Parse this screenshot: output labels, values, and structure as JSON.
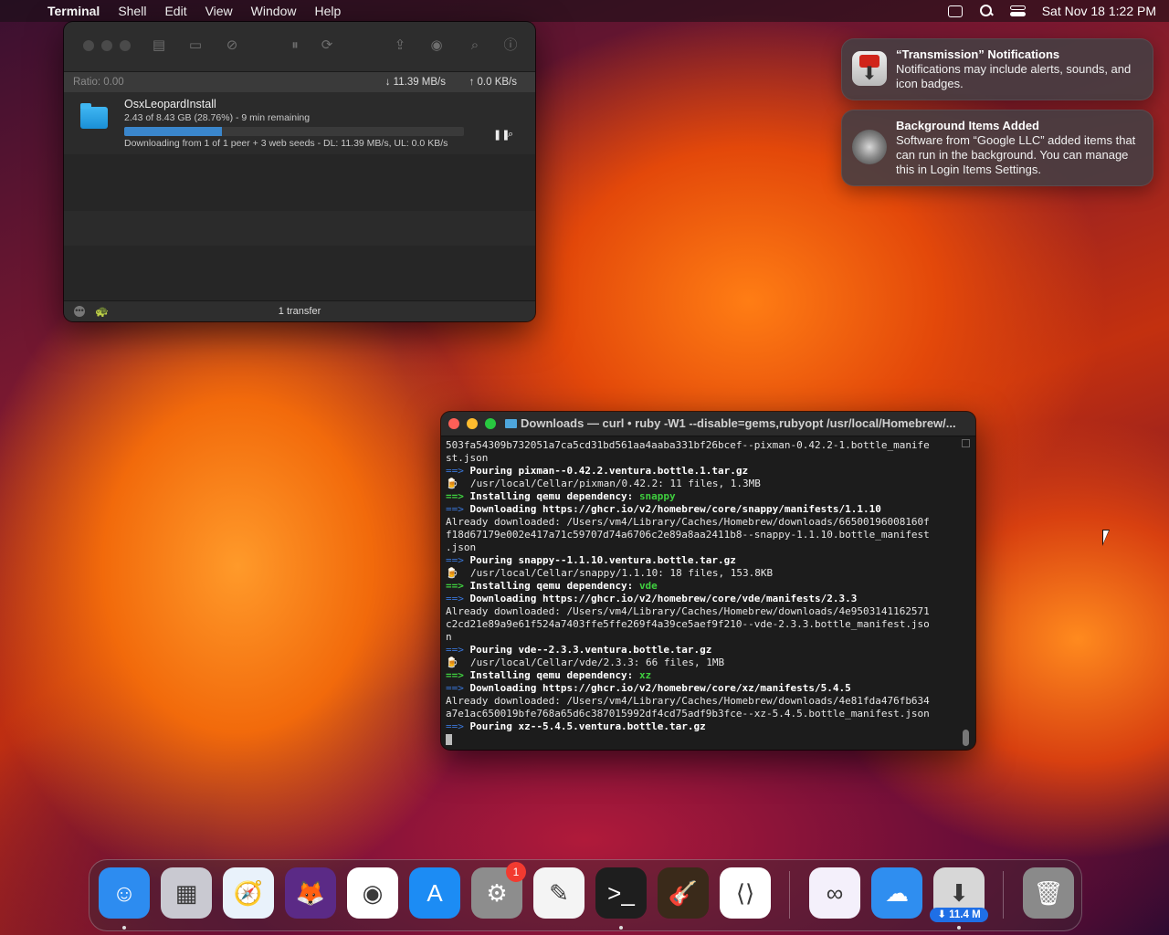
{
  "menubar": {
    "app_name": "Terminal",
    "menus": [
      "Shell",
      "Edit",
      "View",
      "Window",
      "Help"
    ],
    "clock": "Sat Nov 18  1:22 PM"
  },
  "transmission": {
    "ratio": "Ratio: 0.00",
    "download_speed": "↓ 11.39 MB/s",
    "upload_speed": "↑ 0.0 KB/s",
    "torrent": {
      "name": "OsxLeopardInstall",
      "progress_text": "2.43 of 8.43 GB (28.76%) - 9 min remaining",
      "progress_percent": 28.76,
      "status_text": "Downloading from 1 of 1 peer + 3 web seeds - DL: 11.39 MB/s, UL: 0.0 KB/s"
    },
    "footer_count": "1 transfer"
  },
  "notifications": [
    {
      "title": "“Transmission” Notifications",
      "body": "Notifications may include alerts, sounds, and icon badges."
    },
    {
      "title": "Background Items Added",
      "body": "Software from “Google LLC” added items that can run in the background. You can manage this in Login Items Settings."
    }
  ],
  "terminal": {
    "title": "Downloads — curl • ruby -W1 --disable=gems,rubyopt /usr/local/Homebrew/...",
    "lines": [
      {
        "parts": [
          {
            "t": "503fa54309b732051a7ca5cd31bd561aa4aaba331bf26bcef--pixman-0.42.2-1.bottle_manife",
            "c": ""
          }
        ]
      },
      {
        "parts": [
          {
            "t": "st.json",
            "c": ""
          }
        ]
      },
      {
        "parts": [
          {
            "t": "==>",
            "c": "arrow"
          },
          {
            "t": " Pouring pixman--0.42.2.ventura.bottle.1.tar.gz",
            "c": "b"
          }
        ]
      },
      {
        "parts": [
          {
            "t": "🍺  /usr/local/Cellar/pixman/0.42.2: 11 files, 1.3MB",
            "c": ""
          }
        ]
      },
      {
        "parts": [
          {
            "t": "==>",
            "c": "g"
          },
          {
            "t": " Installing qemu dependency: ",
            "c": "b"
          },
          {
            "t": "snappy",
            "c": "g"
          }
        ]
      },
      {
        "parts": [
          {
            "t": "==>",
            "c": "arrow"
          },
          {
            "t": " Downloading https://ghcr.io/v2/homebrew/core/snappy/manifests/1.1.10",
            "c": "b"
          }
        ]
      },
      {
        "parts": [
          {
            "t": "Already downloaded: /Users/vm4/Library/Caches/Homebrew/downloads/66500196008160f",
            "c": ""
          }
        ]
      },
      {
        "parts": [
          {
            "t": "f18d67179e002e417a71c59707d74a6706c2e89a8aa2411b8--snappy-1.1.10.bottle_manifest",
            "c": ""
          }
        ]
      },
      {
        "parts": [
          {
            "t": ".json",
            "c": ""
          }
        ]
      },
      {
        "parts": [
          {
            "t": "==>",
            "c": "arrow"
          },
          {
            "t": " Pouring snappy--1.1.10.ventura.bottle.tar.gz",
            "c": "b"
          }
        ]
      },
      {
        "parts": [
          {
            "t": "🍺  /usr/local/Cellar/snappy/1.1.10: 18 files, 153.8KB",
            "c": ""
          }
        ]
      },
      {
        "parts": [
          {
            "t": "==>",
            "c": "g"
          },
          {
            "t": " Installing qemu dependency: ",
            "c": "b"
          },
          {
            "t": "vde",
            "c": "g"
          }
        ]
      },
      {
        "parts": [
          {
            "t": "==>",
            "c": "arrow"
          },
          {
            "t": " Downloading https://ghcr.io/v2/homebrew/core/vde/manifests/2.3.3",
            "c": "b"
          }
        ]
      },
      {
        "parts": [
          {
            "t": "Already downloaded: /Users/vm4/Library/Caches/Homebrew/downloads/4e9503141162571",
            "c": ""
          }
        ]
      },
      {
        "parts": [
          {
            "t": "c2cd21e89a9e61f524a7403ffe5ffe269f4a39ce5aef9f210--vde-2.3.3.bottle_manifest.jso",
            "c": ""
          }
        ]
      },
      {
        "parts": [
          {
            "t": "n",
            "c": ""
          }
        ]
      },
      {
        "parts": [
          {
            "t": "==>",
            "c": "arrow"
          },
          {
            "t": " Pouring vde--2.3.3.ventura.bottle.tar.gz",
            "c": "b"
          }
        ]
      },
      {
        "parts": [
          {
            "t": "🍺  /usr/local/Cellar/vde/2.3.3: 66 files, 1MB",
            "c": ""
          }
        ]
      },
      {
        "parts": [
          {
            "t": "==>",
            "c": "g"
          },
          {
            "t": " Installing qemu dependency: ",
            "c": "b"
          },
          {
            "t": "xz",
            "c": "g"
          }
        ]
      },
      {
        "parts": [
          {
            "t": "==>",
            "c": "arrow"
          },
          {
            "t": " Downloading https://ghcr.io/v2/homebrew/core/xz/manifests/5.4.5",
            "c": "b"
          }
        ]
      },
      {
        "parts": [
          {
            "t": "Already downloaded: /Users/vm4/Library/Caches/Homebrew/downloads/4e81fda476fb634",
            "c": ""
          }
        ]
      },
      {
        "parts": [
          {
            "t": "a7e1ac650019bfe768a65d6c387015992df4cd75adf9b3fce--xz-5.4.5.bottle_manifest.json",
            "c": ""
          }
        ]
      },
      {
        "parts": [
          {
            "t": "==>",
            "c": "arrow"
          },
          {
            "t": " Pouring xz--5.4.5.ventura.bottle.tar.gz",
            "c": "b"
          }
        ]
      }
    ]
  },
  "dock": {
    "apps": [
      {
        "name": "finder-icon",
        "color": "#2d8cf0",
        "glyph": "☺",
        "running": true
      },
      {
        "name": "launchpad-icon",
        "color": "#c9c9d1",
        "glyph": "▦",
        "running": false
      },
      {
        "name": "safari-icon",
        "color": "#e9f2fb",
        "glyph": "🧭",
        "running": false
      },
      {
        "name": "firefox-icon",
        "color": "#5b2a86",
        "glyph": "🦊",
        "running": false
      },
      {
        "name": "chrome-icon",
        "color": "#ffffff",
        "glyph": "◉",
        "running": false
      },
      {
        "name": "app-store-icon",
        "color": "#1c8cf4",
        "glyph": "A",
        "running": false
      },
      {
        "name": "system-settings-icon",
        "color": "#8d8d8d",
        "glyph": "⚙",
        "running": false,
        "badge": "1"
      },
      {
        "name": "textedit-icon",
        "color": "#f4f4f4",
        "glyph": "✎",
        "running": false
      },
      {
        "name": "terminal-icon",
        "color": "#1e1e1e",
        "glyph": ">_",
        "running": true
      },
      {
        "name": "garageband-icon",
        "color": "#3a2a1a",
        "glyph": "🎸",
        "running": false
      },
      {
        "name": "vscode-icon",
        "color": "#ffffff",
        "glyph": "⟨⟩",
        "running": false
      },
      {
        "name": "visual-studio-icon",
        "color": "#f4f0fb",
        "glyph": "∞",
        "running": false
      },
      {
        "name": "weather-icon",
        "color": "#2f8ef0",
        "glyph": "☁",
        "running": false
      },
      {
        "name": "transmission-icon",
        "color": "#d7d7d7",
        "glyph": "⬇",
        "running": true,
        "download_badge": "⬇ 11.4 M"
      },
      {
        "name": "trash-icon",
        "color": "#8a8a8a",
        "glyph": "🗑",
        "running": false
      }
    ]
  }
}
